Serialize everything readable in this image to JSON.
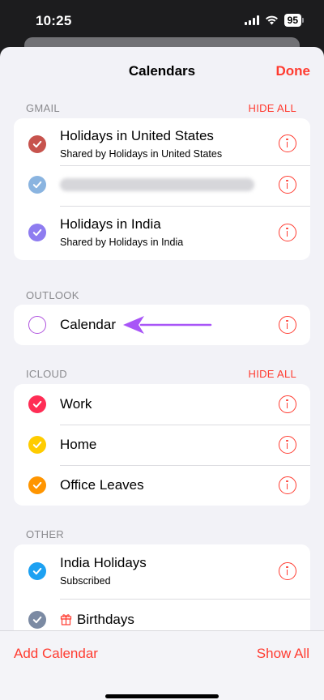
{
  "status": {
    "time": "10:25",
    "battery": "95"
  },
  "nav": {
    "title": "Calendars",
    "done_label": "Done"
  },
  "sections": {
    "gmail": {
      "header": "GMAIL",
      "action": "HIDE ALL",
      "items": [
        {
          "title": "Holidays in United States",
          "subtitle": "Shared by Holidays in United States",
          "color": "#c7534d"
        },
        {
          "title": "",
          "subtitle": "",
          "color": "#8ab4e0"
        },
        {
          "title": "Holidays in India",
          "subtitle": "Shared by Holidays in India",
          "color": "#8e7cf0"
        }
      ]
    },
    "outlook": {
      "header": "OUTLOOK",
      "items": [
        {
          "title": "Calendar",
          "color": "#af52de",
          "checked": false
        }
      ]
    },
    "icloud": {
      "header": "ICLOUD",
      "action": "HIDE ALL",
      "items": [
        {
          "title": "Work",
          "color": "#ff2d55"
        },
        {
          "title": "Home",
          "color": "#ffcc00"
        },
        {
          "title": "Office Leaves",
          "color": "#ff9500"
        }
      ]
    },
    "other": {
      "header": "OTHER",
      "items": [
        {
          "title": "India Holidays",
          "subtitle": "Subscribed",
          "color": "#1da1f2"
        },
        {
          "title": "Birthdays",
          "color": "#7b8aa3",
          "icon": "gift-icon"
        }
      ]
    }
  },
  "toolbar": {
    "add_label": "Add Calendar",
    "show_all_label": "Show All"
  },
  "colors": {
    "accent": "#ff3b30",
    "annotation_arrow": "#a855f7"
  }
}
